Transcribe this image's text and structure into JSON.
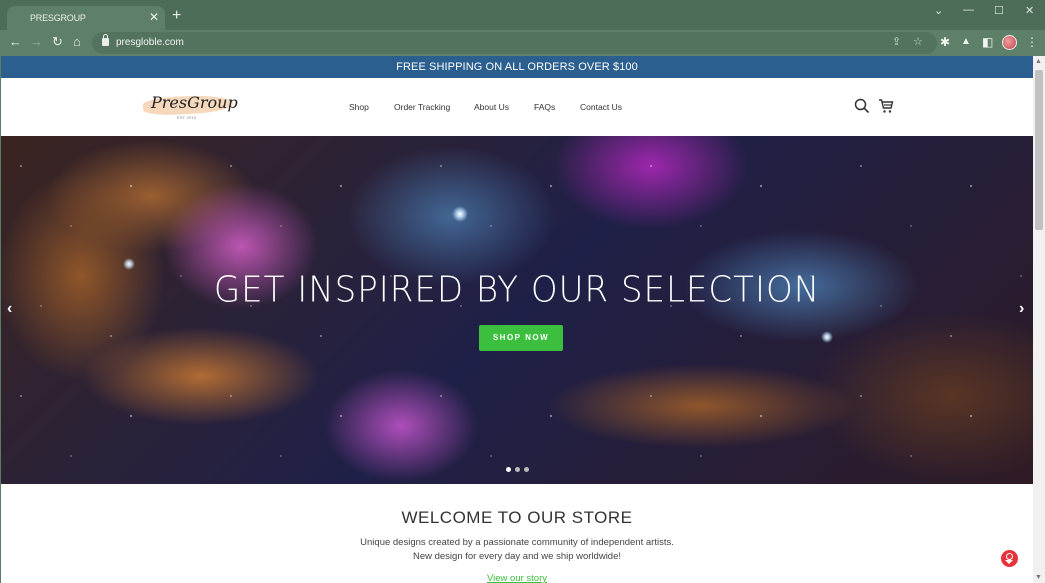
{
  "browser": {
    "tab_title": "PRESGROUP",
    "tab_close": "✕",
    "new_tab": "+",
    "url": "presgloble.com",
    "window_controls": {
      "dropdown": "⌄",
      "minimize": "—",
      "maximize": "☐",
      "close": "✕"
    },
    "nav": {
      "back": "←",
      "forward": "→",
      "reload": "↻",
      "home": "⌂"
    },
    "omnibox_icons": {
      "share": "⇪",
      "bookmark": "☆"
    },
    "extensions": {
      "puzzle": "✱",
      "lab": "▲",
      "sidebar": "◧"
    },
    "menu": "⋮"
  },
  "announcement": "FREE SHIPPING ON ALL ORDERS OVER $100",
  "header": {
    "logo_text": "PresGroup",
    "logo_subtext": "EST 2019",
    "nav": [
      {
        "label": "Shop"
      },
      {
        "label": "Order Tracking"
      },
      {
        "label": "About Us"
      },
      {
        "label": "FAQs"
      },
      {
        "label": "Contact Us"
      }
    ]
  },
  "hero": {
    "title": "GET INSPIRED BY OUR SELECTION",
    "cta_label": "SHOP NOW",
    "prev_arrow": "‹",
    "next_arrow": "›",
    "slide_count": 3,
    "active_slide": 1
  },
  "welcome": {
    "heading": "WELCOME TO OUR STORE",
    "line1": "Unique designs created by a passionate community of independent artists.",
    "line2": "New design for every day and we ship worldwide!",
    "link_label": "View our story"
  },
  "colors": {
    "announcement_bg": "#2b5f8f",
    "cta_green": "#3cbf3e",
    "chat_red": "#e5333b",
    "browser_frame": "#5b7c65"
  }
}
